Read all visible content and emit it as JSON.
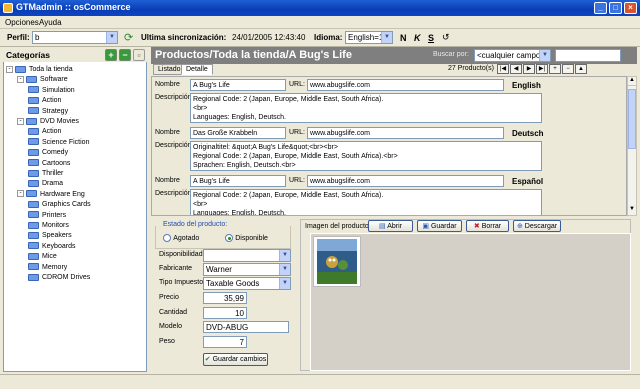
{
  "window": {
    "title": "GTMadmin :: osCommerce"
  },
  "menu": [
    "Opciones",
    "Ayuda"
  ],
  "toolbar": {
    "perfil_label": "Perfil:",
    "perfil_value": "b",
    "sync_label": "Ultima sincronización:",
    "sync_value": "24/01/2005 12:43:40",
    "idioma_label": "Idioma:",
    "idioma_value": "English=1",
    "fmt_buttons": [
      "N",
      "K",
      "S"
    ]
  },
  "left": {
    "header": "Categorías",
    "tree": [
      {
        "label": "Toda la tienda",
        "level": 0,
        "expander": "-"
      },
      {
        "label": "Software",
        "level": 1,
        "expander": "-"
      },
      {
        "label": "Simulation",
        "level": 2
      },
      {
        "label": "Action",
        "level": 2
      },
      {
        "label": "Strategy",
        "level": 2
      },
      {
        "label": "DVD Movies",
        "level": 1,
        "expander": "-"
      },
      {
        "label": "Action",
        "level": 2
      },
      {
        "label": "Science Fiction",
        "level": 2
      },
      {
        "label": "Comedy",
        "level": 2
      },
      {
        "label": "Cartoons",
        "level": 2
      },
      {
        "label": "Thriller",
        "level": 2
      },
      {
        "label": "Drama",
        "level": 2
      },
      {
        "label": "Hardware Eng",
        "level": 1,
        "expander": "-"
      },
      {
        "label": "Graphics Cards",
        "level": 2
      },
      {
        "label": "Printers",
        "level": 2
      },
      {
        "label": "Monitors",
        "level": 2
      },
      {
        "label": "Speakers",
        "level": 2
      },
      {
        "label": "Keyboards",
        "level": 2
      },
      {
        "label": "Mice",
        "level": 2
      },
      {
        "label": "Memory",
        "level": 2
      },
      {
        "label": "CDROM Drives",
        "level": 2
      }
    ]
  },
  "main": {
    "header": "Productos/Toda la tienda/A Bug's Life",
    "search_label": "Buscar por:",
    "search_field": "<cualquier campo>",
    "search_value": "",
    "tabs": [
      "Listado",
      "Detalle"
    ],
    "count": "27 Producto(s)",
    "nav_buttons": [
      "|◀",
      "◀",
      "▶",
      "▶|",
      "+",
      "−",
      "▲"
    ],
    "labels": {
      "nombre": "Nombre",
      "url": "URL:",
      "descripcion": "Descripción"
    },
    "rows": [
      {
        "nombre": "A Bug's Life",
        "url": "www.abugslife.com",
        "lang": "English",
        "desc": "Regional Code: 2 (Japan, Europe, Middle East, South Africa).\n<br>\nLanguages: English, Deutsch."
      },
      {
        "nombre": "Das Große Krabbeln",
        "url": "www.abugslife.com",
        "lang": "Deutsch",
        "desc": "Originaltitel: &quot;A Bug's Life&quot;<br><br>\nRegional Code: 2 (Japan, Europe, Middle East, South Africa).<br>\nSprachen: English, Deutsch.<br>"
      },
      {
        "nombre": "A Bug's Life",
        "url": "www.abugslife.com",
        "lang": "Español",
        "desc": "Regional Code: 2 (Japan, Europe, Middle East, South Africa).\n<br>\nLanguages: English, Deutsch."
      }
    ]
  },
  "detail": {
    "estado_label": "Estado del producto:",
    "agotado": "Agotado",
    "disponible": "Disponible",
    "disponibilidad_label": "Disponibilidad",
    "disponibilidad_value": "",
    "fabricante_label": "Fabricante",
    "fabricante_value": "Warner",
    "tipo_label": "Tipo Impuesto",
    "tipo_value": "Taxable Goods",
    "precio_label": "Precio",
    "precio_value": "35,99",
    "cantidad_label": "Cantidad",
    "cantidad_value": "10",
    "modelo_label": "Modelo",
    "modelo_value": "DVD-ABUG",
    "peso_label": "Peso",
    "peso_value": "7",
    "save_label": "Guardar cambios"
  },
  "image": {
    "label": "Imagen del producto:",
    "abrir": "Abrir",
    "guardar": "Guardar",
    "borrar": "Borrar",
    "descargar": "Descargar"
  },
  "colors": {
    "title_blue": "#0a3db5",
    "header_gray": "#7f7f7f",
    "bg": "#ece9d8"
  }
}
